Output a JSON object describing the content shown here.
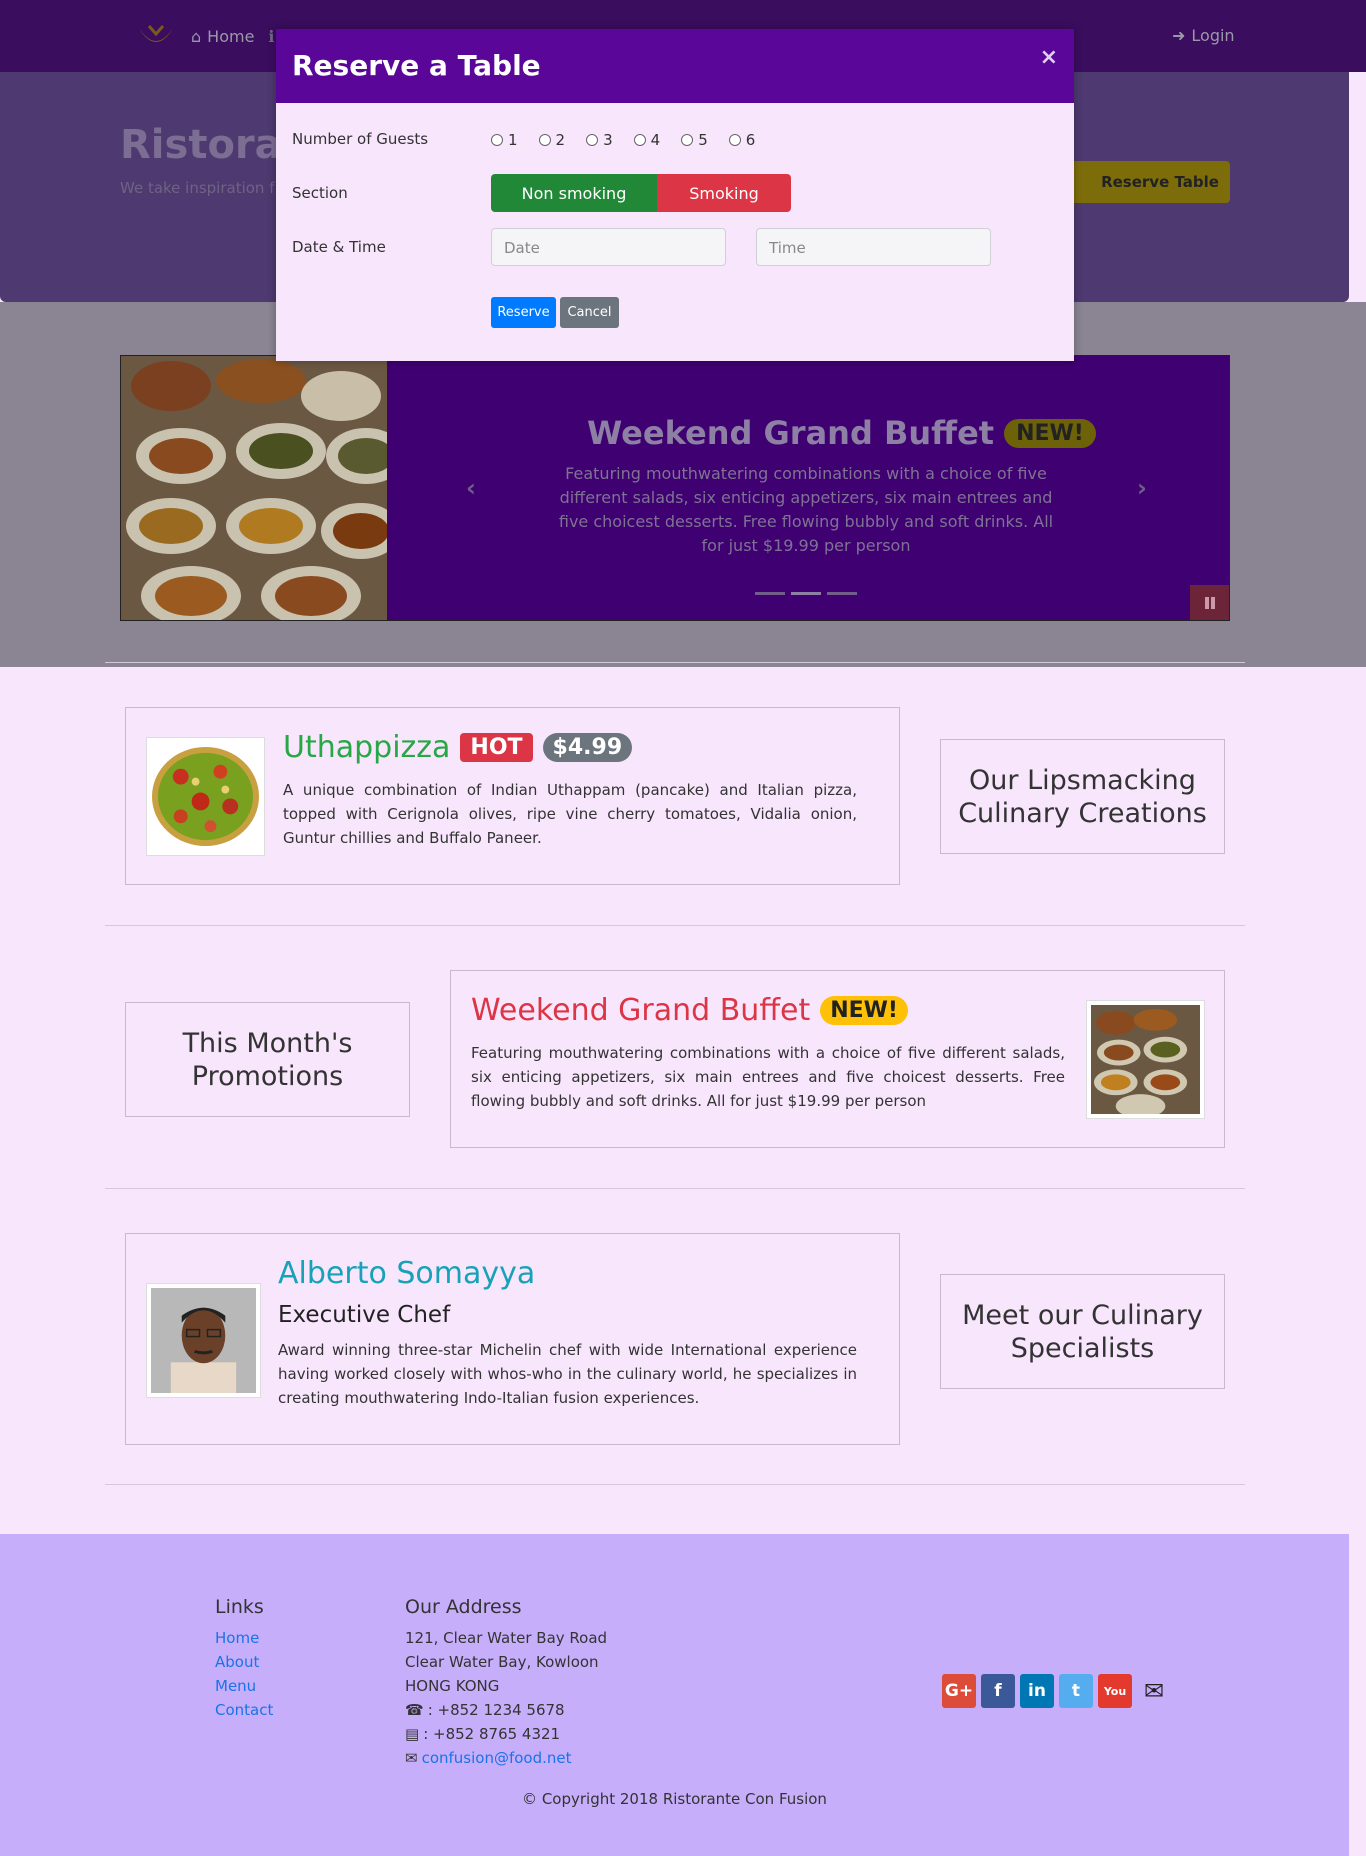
{
  "nav": {
    "home": "Home",
    "login": "Login"
  },
  "jumbotron": {
    "title": "Ristorante",
    "desc": "We take inspiration f fusion experience. Our",
    "reserve_button": "Reserve Table"
  },
  "carousel": {
    "title": "Weekend Grand Buffet",
    "badge": "NEW!",
    "text": "Featuring mouthwatering combinations with a choice of five different salads, six enticing appetizers, six main entrees and five choicest desserts. Free flowing bubbly and soft drinks. All for just $19.99 per person"
  },
  "modal": {
    "title": "Reserve a Table",
    "close": "×",
    "guests_label": "Number of Guests",
    "guest_options": [
      "1",
      "2",
      "3",
      "4",
      "5",
      "6"
    ],
    "section_label": "Section",
    "non_smoking": "Non smoking",
    "smoking": "Smoking",
    "datetime_label": "Date & Time",
    "date_placeholder": "Date",
    "time_placeholder": "Time",
    "reserve": "Reserve",
    "cancel": "Cancel"
  },
  "dish": {
    "name": "Uthappizza",
    "badge": "HOT",
    "price": "$4.99",
    "desc": "A unique combination of Indian Uthappam (pancake) and Italian pizza, topped with Cerignola olives, ripe vine cherry tomatoes, Vidalia onion, Guntur chillies and Buffalo Paneer.",
    "side": "Our Lipsmacking Culinary Creations"
  },
  "promotion": {
    "name": "Weekend Grand Buffet",
    "badge": "NEW!",
    "desc": "Featuring mouthwatering combinations with a choice of five different salads, six enticing appetizers, six main entrees and five choicest desserts. Free flowing bubbly and soft drinks. All for just $19.99 per person",
    "side": "This Month's Promotions"
  },
  "leader": {
    "name": "Alberto Somayya",
    "designation": "Executive Chef",
    "desc": "Award winning three-star Michelin chef with wide International experience having worked closely with whos-who in the culinary world, he specializes in creating mouthwatering Indo-Italian fusion experiences.",
    "side": "Meet our Culinary Specialists"
  },
  "footer": {
    "links_heading": "Links",
    "links": [
      "Home",
      "About",
      "Menu",
      "Contact"
    ],
    "address_heading": "Our Address",
    "address": [
      "121, Clear Water Bay Road",
      "Clear Water Bay, Kowloon",
      "HONG KONG"
    ],
    "phone": ": +852 1234 5678",
    "fax": ": +852 8765 4321",
    "email": "confusion@food.net",
    "copyright": "© Copyright 2018 Ristorante Con Fusion"
  },
  "colors": {
    "primary": "#5a0799",
    "accent": "#ffc107",
    "danger": "#dc3545",
    "success": "#28a745"
  }
}
